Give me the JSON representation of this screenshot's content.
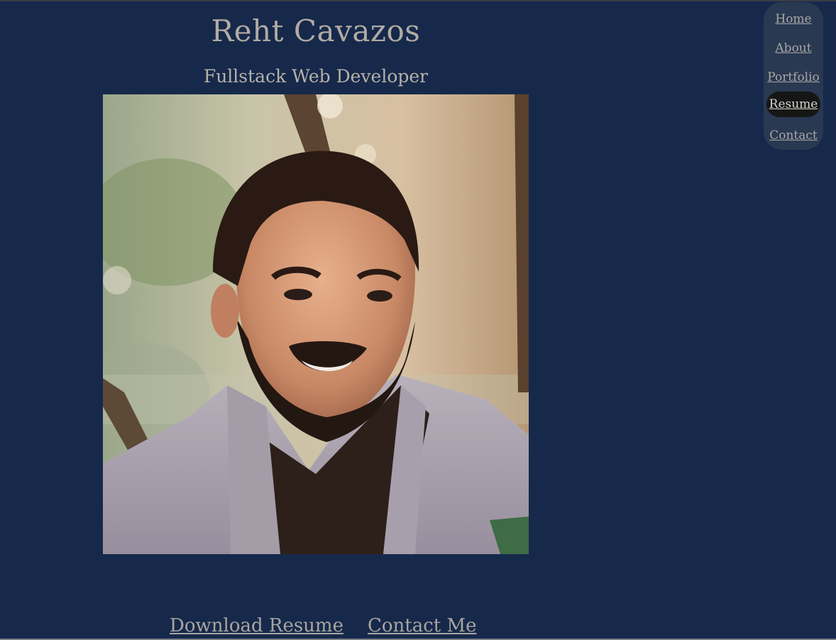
{
  "header": {
    "name": "Reht Cavazos",
    "tagline": "Fullstack Web Developer"
  },
  "nav": {
    "items": [
      {
        "label": "Home",
        "active": false
      },
      {
        "label": "About",
        "active": false
      },
      {
        "label": "Portfolio",
        "active": false
      },
      {
        "label": "Resume",
        "active": true
      },
      {
        "label": "Contact",
        "active": false
      }
    ]
  },
  "actions": {
    "download_resume": "Download Resume",
    "contact_me": "Contact Me"
  },
  "colors": {
    "background": "#16294b",
    "nav_background": "#293951",
    "nav_active": "#161616",
    "text": "#b2aca4"
  }
}
